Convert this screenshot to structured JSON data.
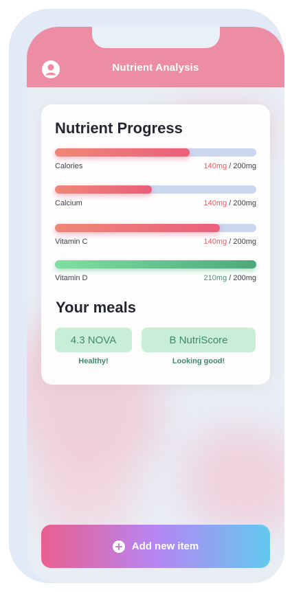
{
  "header": {
    "title": "Nutrient Analysis",
    "avatar_icon": "user-circle-icon"
  },
  "nutrient_progress": {
    "title": "Nutrient Progress",
    "items": [
      {
        "label": "Calories",
        "current": "140mg",
        "target": "/ 200mg",
        "progress": 0.67,
        "status_color": "#e85a5e"
      },
      {
        "label": "Calcium",
        "current": "140mg",
        "target": "/ 200mg",
        "progress": 0.48,
        "status_color": "#e85a5e"
      },
      {
        "label": "Vitamin C",
        "current": "140mg",
        "target": "/ 200mg",
        "progress": 0.82,
        "status_color": "#e85a5e"
      },
      {
        "label": "Vitamin D",
        "current": "210mg",
        "target": "/ 200mg",
        "progress": 1.0,
        "status_color": "#3e9a6b"
      }
    ]
  },
  "meals": {
    "title": "Your meals",
    "nova": {
      "label": "4.3 NOVA",
      "subtitle": "Healthy!"
    },
    "nutriscore": {
      "label": "B NutriScore",
      "subtitle": "Looking good!"
    }
  },
  "action": {
    "add_label": "Add new item",
    "icon": "plus-circle-icon"
  },
  "colors": {
    "header": "#ec8da4",
    "accent_red": "#e85a5e",
    "accent_green": "#3e9a6b",
    "pill_bg": "#c8eed8"
  }
}
